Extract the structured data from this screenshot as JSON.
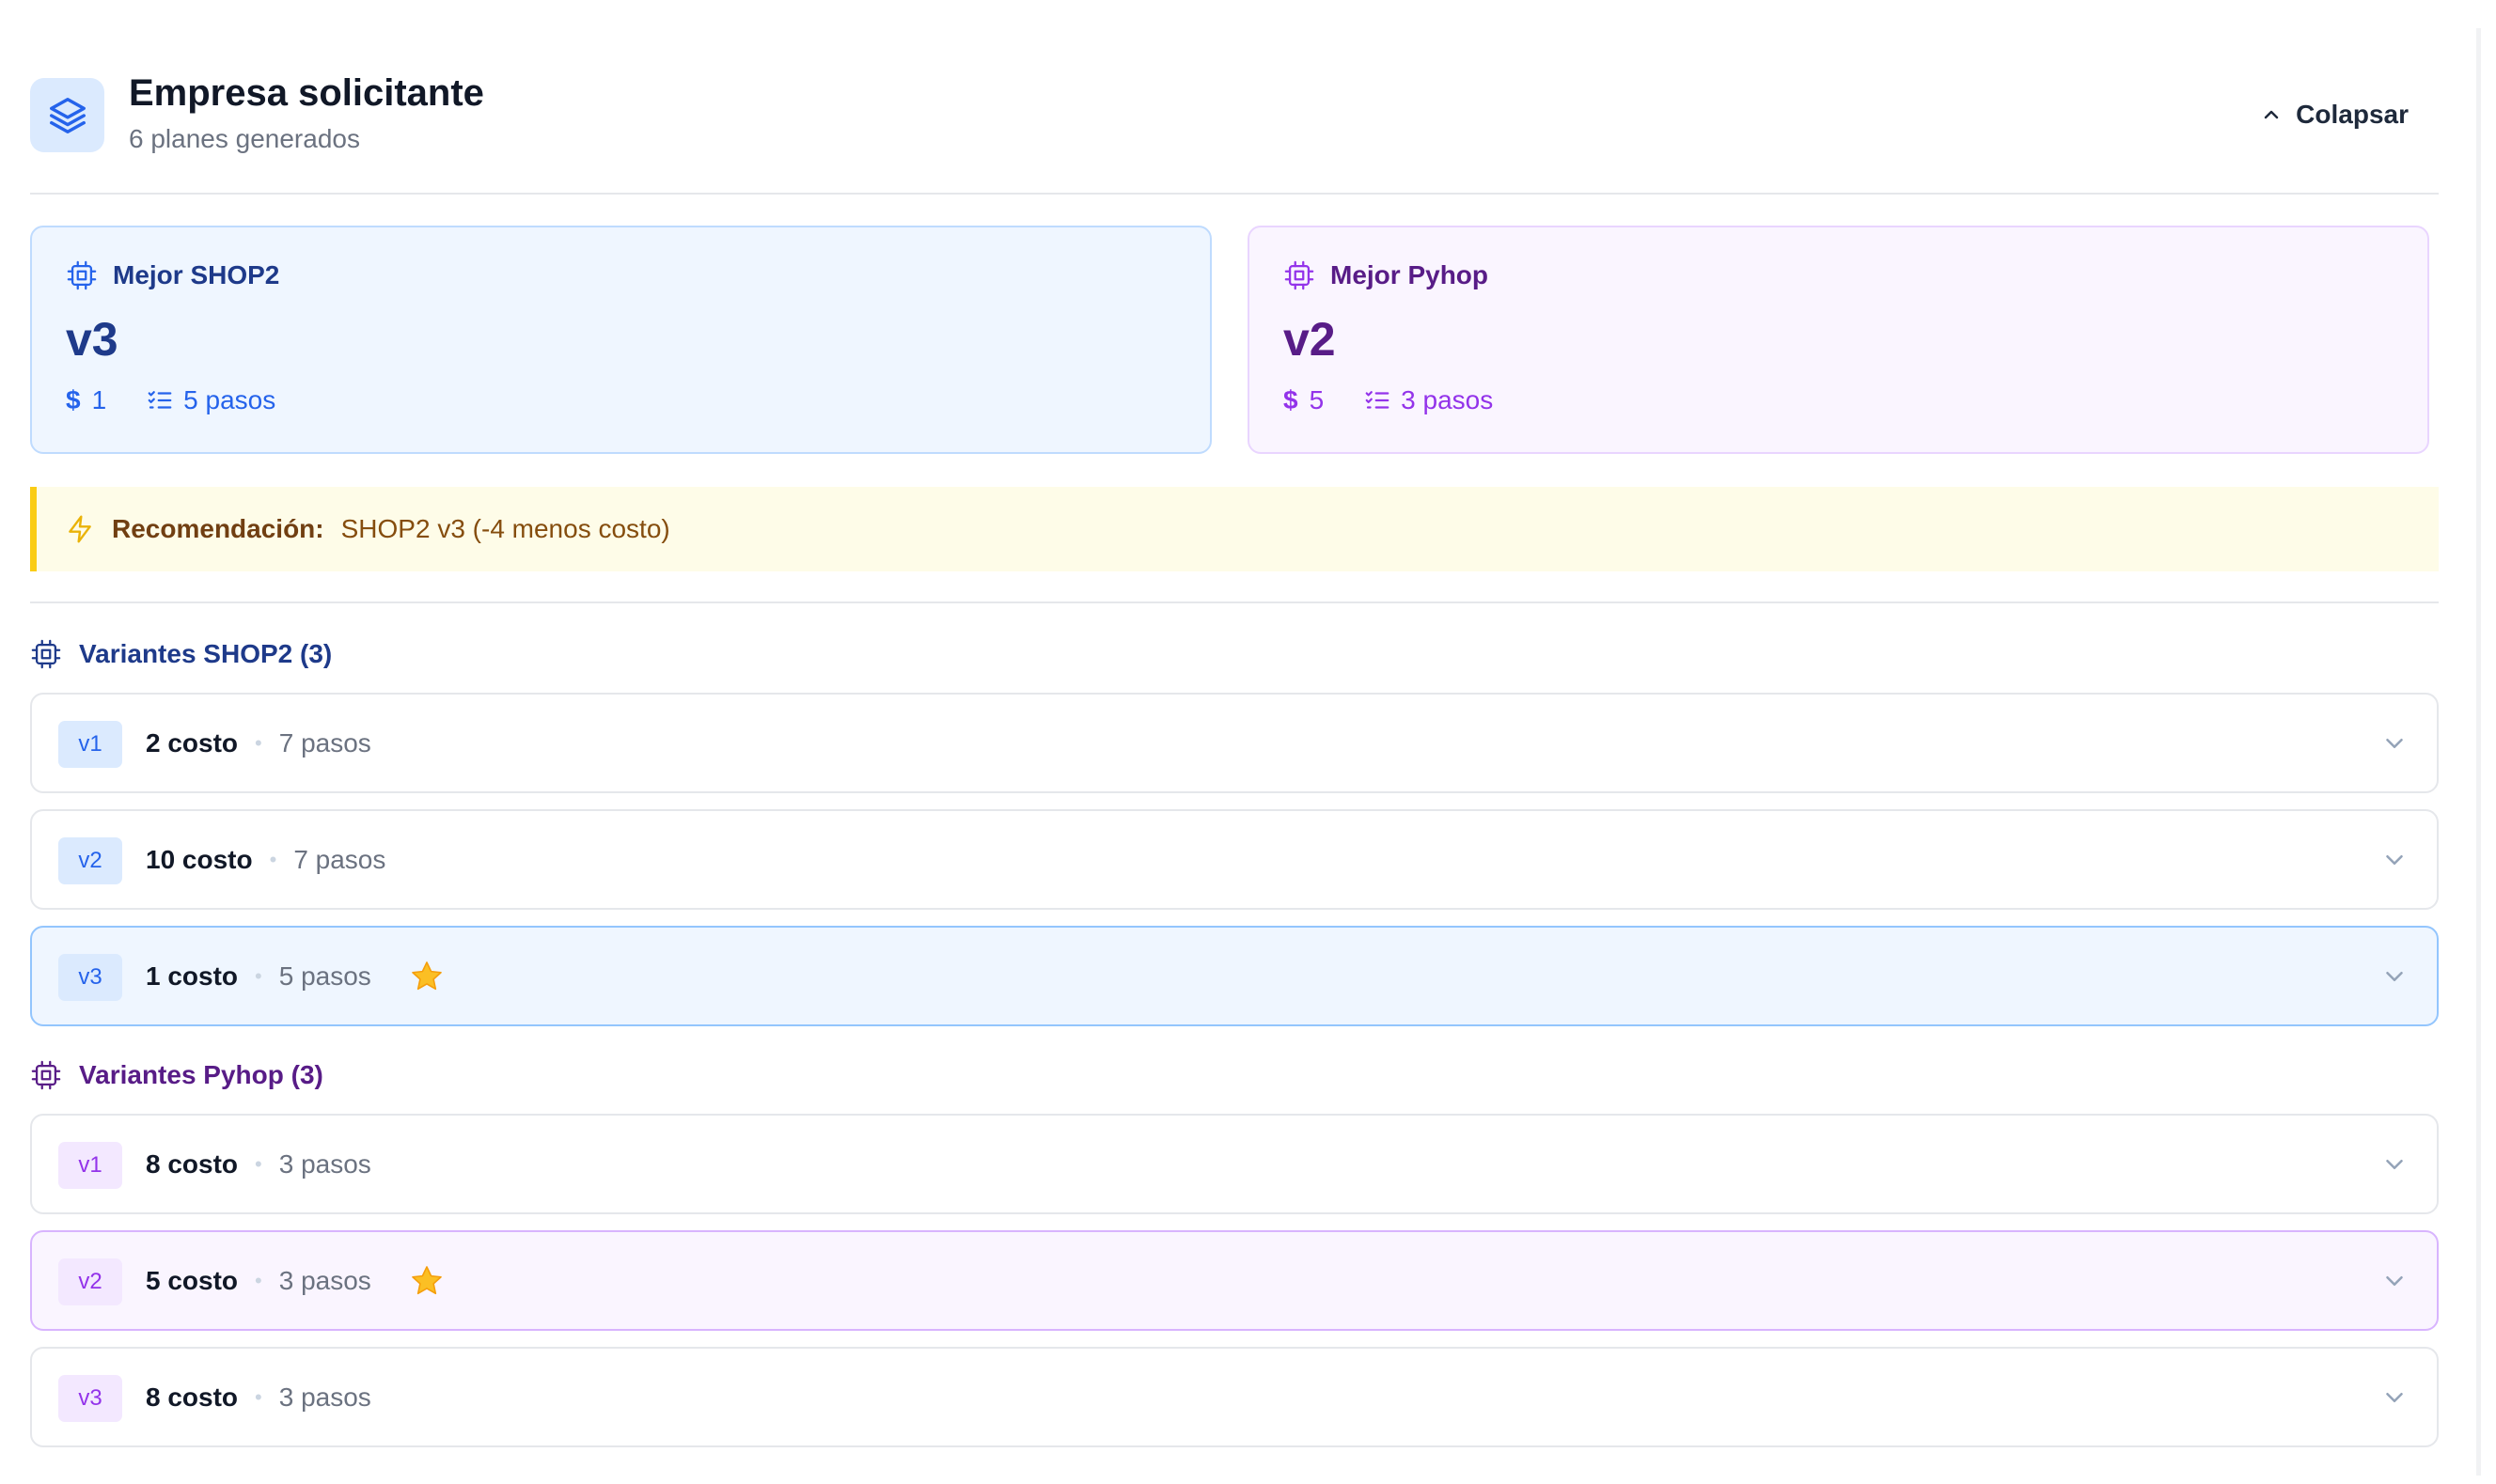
{
  "header": {
    "title": "Empresa solicitante",
    "subtitle": "6 planes generados",
    "collapse_label": "Colapsar"
  },
  "best": {
    "shop": {
      "label": "Mejor SHOP2",
      "version": "v3",
      "currency_symbol": "$",
      "cost": "1",
      "steps": "5 pasos"
    },
    "pyhop": {
      "label": "Mejor Pyhop",
      "version": "v2",
      "currency_symbol": "$",
      "cost": "5",
      "steps": "3 pasos"
    }
  },
  "recommendation": {
    "label": "Recomendación:",
    "text": "SHOP2 v3 (-4 menos costo)"
  },
  "sections": {
    "shop": {
      "title": "Variantes SHOP2 (3)",
      "variants": [
        {
          "tag": "v1",
          "cost": "2 costo",
          "steps": "7 pasos",
          "best": false
        },
        {
          "tag": "v2",
          "cost": "10 costo",
          "steps": "7 pasos",
          "best": false
        },
        {
          "tag": "v3",
          "cost": "1 costo",
          "steps": "5 pasos",
          "best": true
        }
      ]
    },
    "pyhop": {
      "title": "Variantes Pyhop (3)",
      "variants": [
        {
          "tag": "v1",
          "cost": "8 costo",
          "steps": "3 pasos",
          "best": false
        },
        {
          "tag": "v2",
          "cost": "5 costo",
          "steps": "3 pasos",
          "best": true
        },
        {
          "tag": "v3",
          "cost": "8 costo",
          "steps": "3 pasos",
          "best": false
        }
      ]
    }
  },
  "separator": "•",
  "colors": {
    "shop_accent": "#2563eb",
    "pyhop_accent": "#9333ea",
    "recommend_border": "#facc15",
    "star": "#fbbf24"
  },
  "icons": {
    "header": "layers-icon",
    "collapse": "chevron-up-icon",
    "engine": "cpu-icon",
    "cost": "dollar-icon",
    "steps": "list-checks-icon",
    "recommendation": "zap-icon",
    "best_variant": "star-icon",
    "expand": "chevron-down-icon"
  }
}
